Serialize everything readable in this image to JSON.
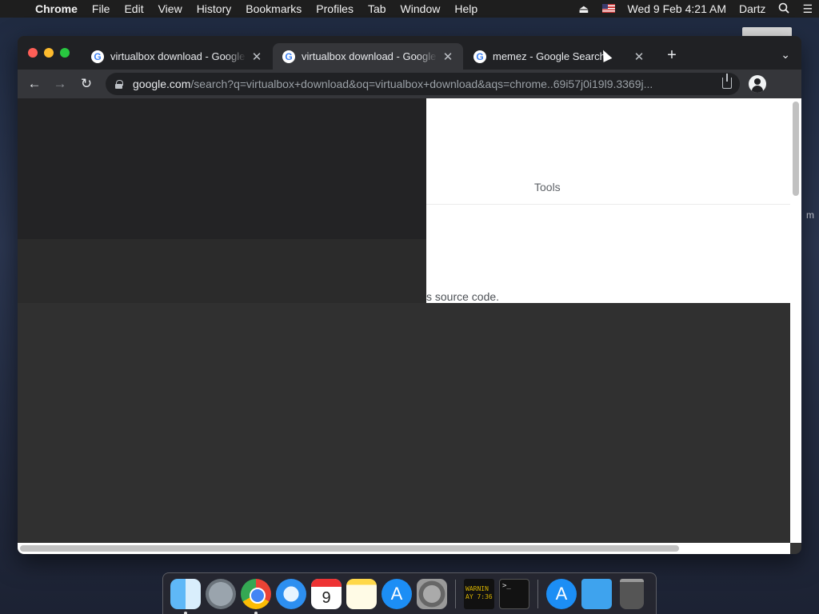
{
  "menubar": {
    "app_name": "Chrome",
    "menus": [
      "File",
      "Edit",
      "View",
      "History",
      "Bookmarks",
      "Profiles",
      "Tab",
      "Window",
      "Help"
    ],
    "datetime": "Wed 9 Feb  4:21 AM",
    "user": "Dartz",
    "icons": [
      "apple-icon",
      "eject-icon",
      "us-flag-icon",
      "spotlight-search-icon",
      "control-center-icon"
    ]
  },
  "browser": {
    "tabs": [
      {
        "title": "virtualbox download - Google Search",
        "active": false
      },
      {
        "title": "virtualbox download - Google Search",
        "active": true
      },
      {
        "title": "memez - Google Search",
        "active": false
      }
    ],
    "favicon_glyph": "G",
    "close_glyph": "✕",
    "newtab_glyph": "+",
    "tab_search_glyph": "⌄",
    "nav": {
      "back": "←",
      "forward": "→",
      "reload": "↻"
    },
    "url": {
      "host": "google.com",
      "rest": "/search?q=virtualbox+download&oq=virtualbox+download&aqs=chrome..69i57j0i19l9.3369j..."
    }
  },
  "page": {
    "tools_label": "Tools",
    "snippet_text": "s source code."
  },
  "desktop": {
    "fragment_text": "m"
  },
  "dock": {
    "calendar": {
      "month": "FEB",
      "day": "9"
    },
    "console_text": "WARNIN\nAY 7:36",
    "terminal_text": ">_",
    "items": [
      "Finder",
      "Launchpad",
      "Google Chrome",
      "Safari",
      "Calendar",
      "Notes",
      "App Store",
      "System Preferences",
      "Console",
      "Terminal",
      "App Store",
      "Downloads",
      "Trash"
    ]
  },
  "colors": {
    "tabstrip_bg": "#202124",
    "toolbar_bg": "#35363a",
    "page_dark": "#303030",
    "page_white": "#ffffff"
  }
}
